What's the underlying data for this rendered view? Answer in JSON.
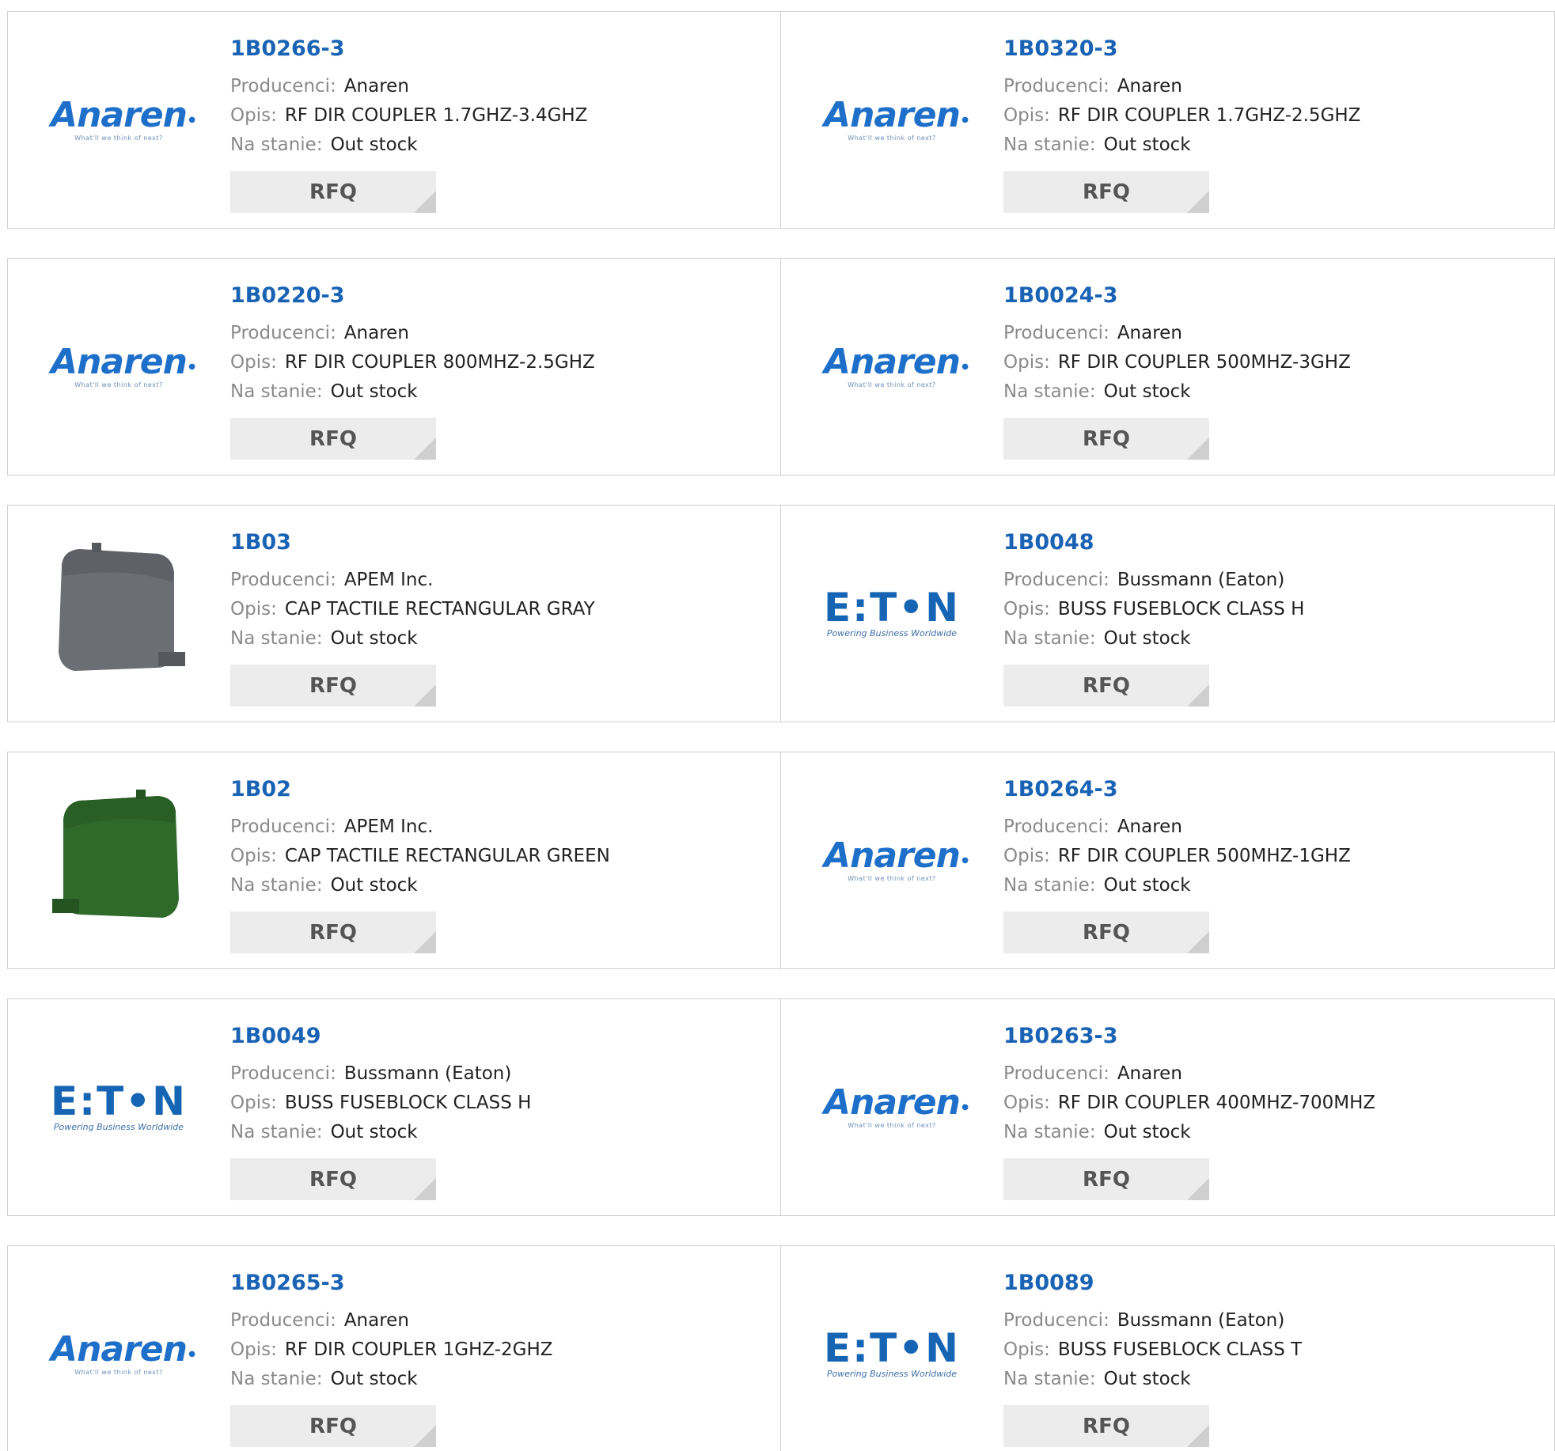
{
  "labels": {
    "manufacturer": "Producenci:",
    "description": "Opis:",
    "stock": "Na stanie:",
    "rfq": "RFQ"
  },
  "brand_logos": {
    "anaren": {
      "name": "Anaren",
      "tagline": "What'll we think of next?"
    },
    "eaton": {
      "name": "E:T•N",
      "tagline": "Powering Business Worldwide"
    }
  },
  "products": [
    {
      "part": "1B0266-3",
      "manufacturer": "Anaren",
      "description": "RF DIR COUPLER 1.7GHZ-3.4GHZ",
      "stock": "Out stock",
      "image": "anaren-logo"
    },
    {
      "part": "1B0320-3",
      "manufacturer": "Anaren",
      "description": "RF DIR COUPLER 1.7GHZ-2.5GHZ",
      "stock": "Out stock",
      "image": "anaren-logo"
    },
    {
      "part": "1B0220-3",
      "manufacturer": "Anaren",
      "description": "RF DIR COUPLER 800MHZ-2.5GHZ",
      "stock": "Out stock",
      "image": "anaren-logo"
    },
    {
      "part": "1B0024-3",
      "manufacturer": "Anaren",
      "description": "RF DIR COUPLER 500MHZ-3GHZ",
      "stock": "Out stock",
      "image": "anaren-logo"
    },
    {
      "part": "1B03",
      "manufacturer": "APEM Inc.",
      "description": "CAP TACTILE RECTANGULAR GRAY",
      "stock": "Out stock",
      "image": "gray-cap-photo"
    },
    {
      "part": "1B0048",
      "manufacturer": "Bussmann (Eaton)",
      "description": "BUSS FUSEBLOCK CLASS H",
      "stock": "Out stock",
      "image": "eaton-logo"
    },
    {
      "part": "1B02",
      "manufacturer": "APEM Inc.",
      "description": "CAP TACTILE RECTANGULAR GREEN",
      "stock": "Out stock",
      "image": "green-cap-photo"
    },
    {
      "part": "1B0264-3",
      "manufacturer": "Anaren",
      "description": "RF DIR COUPLER 500MHZ-1GHZ",
      "stock": "Out stock",
      "image": "anaren-logo"
    },
    {
      "part": "1B0049",
      "manufacturer": "Bussmann (Eaton)",
      "description": "BUSS FUSEBLOCK CLASS H",
      "stock": "Out stock",
      "image": "eaton-logo"
    },
    {
      "part": "1B0263-3",
      "manufacturer": "Anaren",
      "description": "RF DIR COUPLER 400MHZ-700MHZ",
      "stock": "Out stock",
      "image": "anaren-logo"
    },
    {
      "part": "1B0265-3",
      "manufacturer": "Anaren",
      "description": "RF DIR COUPLER 1GHZ-2GHZ",
      "stock": "Out stock",
      "image": "anaren-logo"
    },
    {
      "part": "1B0089",
      "manufacturer": "Bussmann (Eaton)",
      "description": "BUSS FUSEBLOCK CLASS T",
      "stock": "Out stock",
      "image": "eaton-logo"
    }
  ],
  "colors": {
    "part_link": "#1a63b4",
    "label_gray": "#8a8a8a",
    "rfq_bg": "#ececec",
    "card_border": "#d0d0d0",
    "gray_cap": "#6b6e73",
    "green_cap": "#2f6a2a"
  }
}
